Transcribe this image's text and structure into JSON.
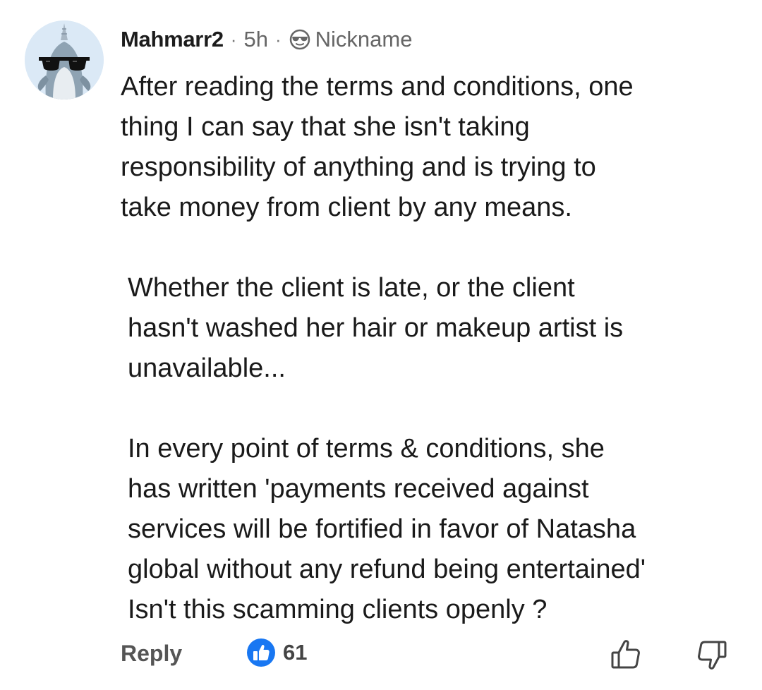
{
  "comment": {
    "author": "Mahmarr2",
    "separator_1": "·",
    "age": "5h",
    "separator_2": "·",
    "badge_label": "Nickname",
    "paragraphs": [
      "After reading the terms and conditions, one\nthing I can say that she isn't taking\nresponsibility of anything and is trying to\ntake money from client by any means.",
      "Whether the client is late, or the client\nhasn't washed her hair or makeup artist is\nunavailable...",
      "In every point of terms & conditions, she\nhas written 'payments received against\nservices will be fortified in favor of Natasha\nglobal without any refund being entertained'\nIsn't this scamming clients openly ?"
    ]
  },
  "actions": {
    "reply_label": "Reply",
    "upvote_count": "61"
  },
  "icons": {
    "avatar": "narwhal-sunglasses-avatar",
    "badge": "sunglasses-face-icon",
    "upvote_badge": "thumbs-up-badge-icon",
    "like": "thumbs-up-outline-icon",
    "dislike": "thumbs-down-outline-icon"
  },
  "colors": {
    "upvote_badge": "#1877f2",
    "avatar_bg": "#dbe9f6",
    "text": "#1a1a1a",
    "muted": "#666666"
  }
}
